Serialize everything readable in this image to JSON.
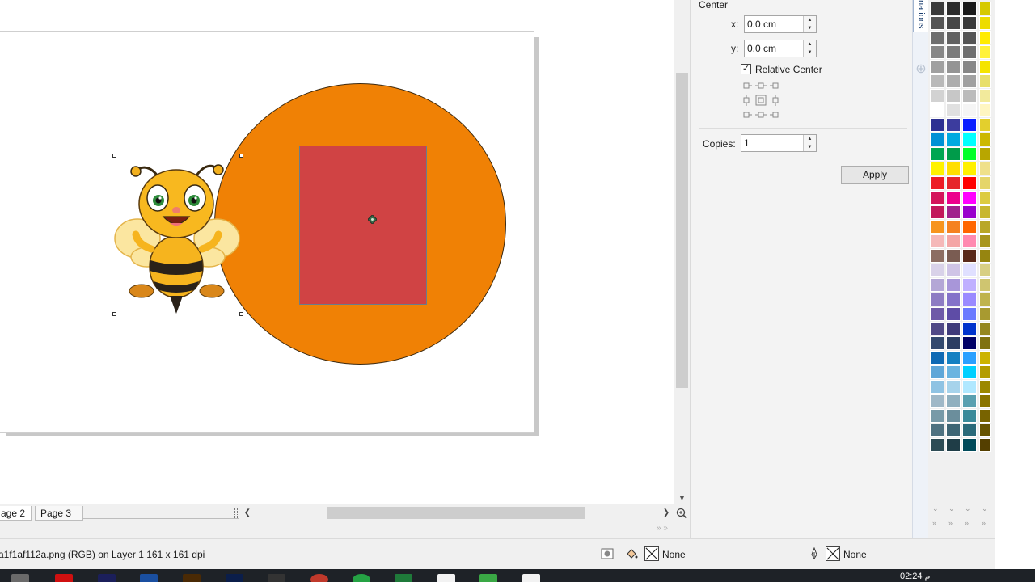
{
  "docker": {
    "section_title": "Center",
    "x_label": "x:",
    "x_value": "0.0 cm",
    "y_label": "y:",
    "y_value": "0.0 cm",
    "relative_center_label": "Relative Center",
    "relative_center_checked": true,
    "copies_label": "Copies:",
    "copies_value": "1",
    "apply_label": "Apply",
    "tab_label": "nations"
  },
  "pages": {
    "tabs": [
      "age 2",
      "Page 3"
    ]
  },
  "status": {
    "object_info": "a1f1af112a.png (RGB) on Layer 1 161 x 161 dpi",
    "fill_label": "None",
    "outline_label": "None"
  },
  "taskbar": {
    "time": "02:24 م"
  },
  "palette": {
    "columns": [
      [
        "#3a3a3a",
        "#555555",
        "#6e6e6e",
        "#878787",
        "#a0a0a0",
        "#b9b9b9",
        "#d2d2d2",
        "#ffffff",
        "#2e3192",
        "#0091d5",
        "#00a651",
        "#fff200",
        "#ed1c24",
        "#d4145a",
        "#c2185b",
        "#f7941d",
        "#f5b8b8",
        "#8c6d62",
        "#d9d2e9",
        "#b4a7d6",
        "#8e7cc3",
        "#6f5aa8",
        "#514a87",
        "#33496e",
        "#0f6ab4",
        "#5fa7d8",
        "#8fc3e3",
        "#9fb8c7",
        "#789aa8",
        "#4f7281",
        "#2e4c55"
      ],
      [
        "#2b2b2b",
        "#474747",
        "#616161",
        "#7b7b7b",
        "#949494",
        "#adadad",
        "#c7c7c7",
        "#e0e0e0",
        "#3c3c9e",
        "#00a9e0",
        "#009b4a",
        "#ffde00",
        "#e6252b",
        "#ec008c",
        "#a1228c",
        "#f58220",
        "#f4a6a6",
        "#7a5c52",
        "#cfc4e6",
        "#a896d9",
        "#8472c9",
        "#5e4ca6",
        "#3f3b7a",
        "#2c3e63",
        "#1480c2",
        "#6ab4e0",
        "#a6d3eb",
        "#90b0bf",
        "#6b8e9c",
        "#3e6574",
        "#1f3d47"
      ],
      [
        "#1a1a1a",
        "#3a3a3a",
        "#545454",
        "#6e6e6e",
        "#878787",
        "#a1a1a1",
        "#bbbbbb",
        "#f5f5f5",
        "#0a1eff",
        "#00ffff",
        "#00ff2a",
        "#fff000",
        "#ff0000",
        "#ff00ff",
        "#9900cc",
        "#ff6600",
        "#ff8ab0",
        "#5a2a1a",
        "#e0e0ff",
        "#c0b0ff",
        "#9a8aff",
        "#6a7aff",
        "#0033cc",
        "#000066",
        "#2aa0ff",
        "#00d0ff",
        "#b0e8ff",
        "#5aa0b0",
        "#3a8a9a",
        "#2a6a7a",
        "#004a5a"
      ],
      [
        "#d6c900",
        "#eddc00",
        "#ffeb00",
        "#fff23a",
        "#f5e400",
        "#e8df6a",
        "#f2ea9c",
        "#fff6c2",
        "#e3cf2d",
        "#ccb800",
        "#b8a600",
        "#efe08a",
        "#e5d56a",
        "#dccb40",
        "#c8b730",
        "#b9a728",
        "#a89620",
        "#968510",
        "#d8cf84",
        "#cfc570",
        "#bfb34d",
        "#a89a30",
        "#958720",
        "#807210",
        "#ccb300",
        "#b39c00",
        "#9c8800",
        "#8a7500",
        "#786300",
        "#665300",
        "#543f00"
      ]
    ]
  }
}
